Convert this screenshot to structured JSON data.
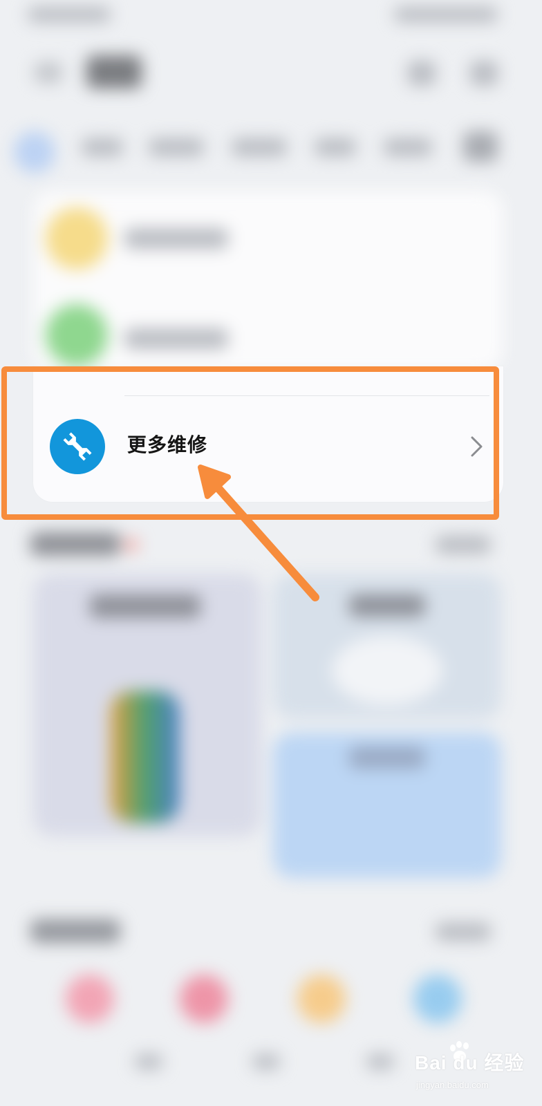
{
  "repair_item": {
    "label": "更多维修",
    "icon": "wrench-icon",
    "icon_bg": "#1296db",
    "chevron": "chevron-right-icon"
  },
  "annotation": {
    "box_color": "#f78c3c",
    "arrow_color": "#f78c3c"
  },
  "watermark": {
    "brand": "Bai du 经验",
    "url": "jingyan.baidu.com"
  }
}
